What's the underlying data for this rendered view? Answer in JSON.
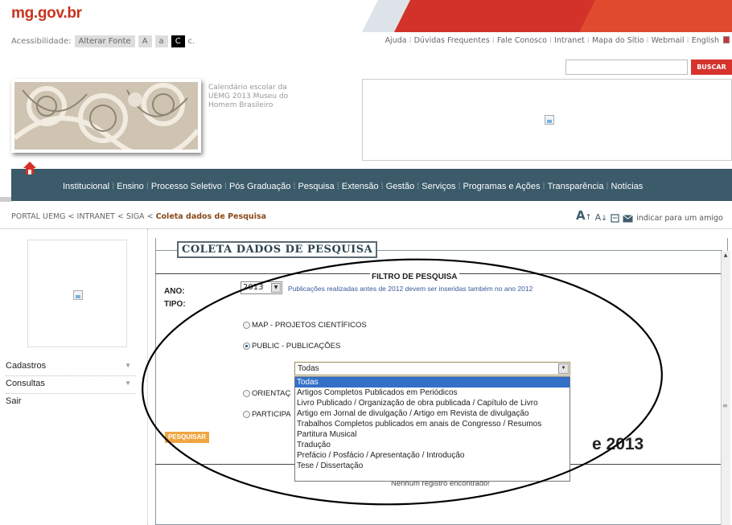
{
  "header": {
    "logo": "mg.gov.br",
    "accessibility": {
      "label": "Acessibilidade:",
      "change_font": "Alterar Fonte",
      "font_big": "A",
      "font_small": "a",
      "contrast": "C",
      "extra": "c."
    },
    "top_links": [
      "Ajuda",
      "Dúvidas Frequentes",
      "Fale Conosco",
      "Intranet",
      "Mapa do Sítio",
      "Webmail",
      "English"
    ],
    "search_button": "BUSCAR",
    "photo_caption": "Calendário escolar da UEMG 2013 Museu do Homem Brasileiro"
  },
  "nav": {
    "items": [
      "Institucional",
      "Ensino",
      "Processo Seletivo",
      "Pós Graduação",
      "Pesquisa",
      "Extensão",
      "Gestão",
      "Serviços",
      "Programas e Ações",
      "Transparência",
      "Notícias"
    ]
  },
  "breadcrumb": {
    "parts": [
      "PORTAL UEMG",
      "INTRANET",
      "SIGA"
    ],
    "separator": " < ",
    "current": "Coleta dados de Pesquisa"
  },
  "tools": {
    "big_a": "A",
    "small_a": "A",
    "recommend": "indicar para um amigo"
  },
  "sidebar": {
    "items": [
      "Cadastros",
      "Consultas",
      "Sair"
    ]
  },
  "main": {
    "title": "COLETA DADOS DE PESQUISA",
    "filter_title": "FILTRO DE PESQUISA",
    "year_label": "ANO:",
    "year_value": "2013",
    "year_note": "Publicações realizadas antes de 2012 devem ser inseridas também no ano 2012",
    "type_label": "TIPO:",
    "types": [
      {
        "label": "MAP - PROJETOS CIENTÍFICOS",
        "checked": false
      },
      {
        "label": "PUBLIC - PUBLICAÇÕES",
        "checked": true
      },
      {
        "label": "ORIENTAÇ",
        "checked": false
      },
      {
        "label": "PARTICIPA",
        "checked": false
      }
    ],
    "category_selected": "Todas",
    "category_options": [
      "Todas",
      "Artigos Completos Publicados em Periódicos",
      "Livro Publicado / Organização de obra publicada / Capítulo de Livro",
      "Artigo em Jornal de divulgação / Artigo em Revista de divulgação",
      "Trabalhos Completos publicados em anais de Congresso / Resumos",
      "Partitura Musical",
      "Tradução",
      "Prefácio / Posfácio / Apresentação / Introdução",
      "Tese / Dissertação"
    ],
    "search_button": "PESQUISAR",
    "year_heading": "e 2013",
    "no_records": "Nenhum registro encontrado!"
  },
  "colors": {
    "logo_red": "#c8341f",
    "nav_bg": "#3b5a6a",
    "search_red": "#d6332d",
    "option_highlight": "#3470c8",
    "pesquisar_orange": "#f0a540"
  }
}
